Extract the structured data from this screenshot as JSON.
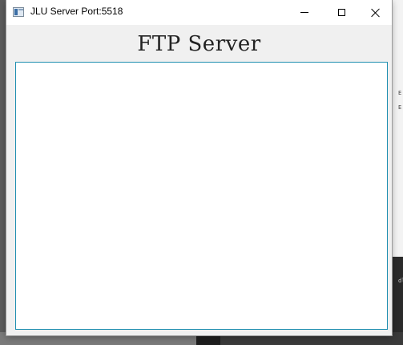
{
  "window": {
    "title": "JLU Server Port:5518",
    "heading": "FTP Server"
  },
  "log": {
    "content": ""
  },
  "controls": {
    "minimize": "minimize-icon",
    "maximize": "maximize-icon",
    "close": "close-icon"
  },
  "background": {
    "glyph_1": "E",
    "glyph_2": "E",
    "glyph_3": "dl"
  },
  "colors": {
    "log_border": "#1f8fb0",
    "window_bg": "#f0f0f0",
    "titlebar_bg": "#ffffff"
  }
}
